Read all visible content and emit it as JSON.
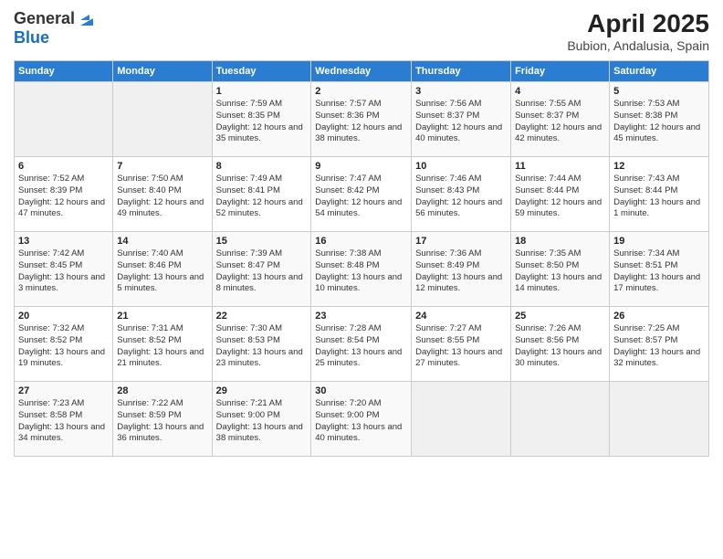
{
  "logo": {
    "general": "General",
    "blue": "Blue"
  },
  "title": "April 2025",
  "subtitle": "Bubion, Andalusia, Spain",
  "headers": [
    "Sunday",
    "Monday",
    "Tuesday",
    "Wednesday",
    "Thursday",
    "Friday",
    "Saturday"
  ],
  "weeks": [
    [
      {
        "day": "",
        "sunrise": "",
        "sunset": "",
        "daylight": ""
      },
      {
        "day": "",
        "sunrise": "",
        "sunset": "",
        "daylight": ""
      },
      {
        "day": "1",
        "sunrise": "Sunrise: 7:59 AM",
        "sunset": "Sunset: 8:35 PM",
        "daylight": "Daylight: 12 hours and 35 minutes."
      },
      {
        "day": "2",
        "sunrise": "Sunrise: 7:57 AM",
        "sunset": "Sunset: 8:36 PM",
        "daylight": "Daylight: 12 hours and 38 minutes."
      },
      {
        "day": "3",
        "sunrise": "Sunrise: 7:56 AM",
        "sunset": "Sunset: 8:37 PM",
        "daylight": "Daylight: 12 hours and 40 minutes."
      },
      {
        "day": "4",
        "sunrise": "Sunrise: 7:55 AM",
        "sunset": "Sunset: 8:37 PM",
        "daylight": "Daylight: 12 hours and 42 minutes."
      },
      {
        "day": "5",
        "sunrise": "Sunrise: 7:53 AM",
        "sunset": "Sunset: 8:38 PM",
        "daylight": "Daylight: 12 hours and 45 minutes."
      }
    ],
    [
      {
        "day": "6",
        "sunrise": "Sunrise: 7:52 AM",
        "sunset": "Sunset: 8:39 PM",
        "daylight": "Daylight: 12 hours and 47 minutes."
      },
      {
        "day": "7",
        "sunrise": "Sunrise: 7:50 AM",
        "sunset": "Sunset: 8:40 PM",
        "daylight": "Daylight: 12 hours and 49 minutes."
      },
      {
        "day": "8",
        "sunrise": "Sunrise: 7:49 AM",
        "sunset": "Sunset: 8:41 PM",
        "daylight": "Daylight: 12 hours and 52 minutes."
      },
      {
        "day": "9",
        "sunrise": "Sunrise: 7:47 AM",
        "sunset": "Sunset: 8:42 PM",
        "daylight": "Daylight: 12 hours and 54 minutes."
      },
      {
        "day": "10",
        "sunrise": "Sunrise: 7:46 AM",
        "sunset": "Sunset: 8:43 PM",
        "daylight": "Daylight: 12 hours and 56 minutes."
      },
      {
        "day": "11",
        "sunrise": "Sunrise: 7:44 AM",
        "sunset": "Sunset: 8:44 PM",
        "daylight": "Daylight: 12 hours and 59 minutes."
      },
      {
        "day": "12",
        "sunrise": "Sunrise: 7:43 AM",
        "sunset": "Sunset: 8:44 PM",
        "daylight": "Daylight: 13 hours and 1 minute."
      }
    ],
    [
      {
        "day": "13",
        "sunrise": "Sunrise: 7:42 AM",
        "sunset": "Sunset: 8:45 PM",
        "daylight": "Daylight: 13 hours and 3 minutes."
      },
      {
        "day": "14",
        "sunrise": "Sunrise: 7:40 AM",
        "sunset": "Sunset: 8:46 PM",
        "daylight": "Daylight: 13 hours and 5 minutes."
      },
      {
        "day": "15",
        "sunrise": "Sunrise: 7:39 AM",
        "sunset": "Sunset: 8:47 PM",
        "daylight": "Daylight: 13 hours and 8 minutes."
      },
      {
        "day": "16",
        "sunrise": "Sunrise: 7:38 AM",
        "sunset": "Sunset: 8:48 PM",
        "daylight": "Daylight: 13 hours and 10 minutes."
      },
      {
        "day": "17",
        "sunrise": "Sunrise: 7:36 AM",
        "sunset": "Sunset: 8:49 PM",
        "daylight": "Daylight: 13 hours and 12 minutes."
      },
      {
        "day": "18",
        "sunrise": "Sunrise: 7:35 AM",
        "sunset": "Sunset: 8:50 PM",
        "daylight": "Daylight: 13 hours and 14 minutes."
      },
      {
        "day": "19",
        "sunrise": "Sunrise: 7:34 AM",
        "sunset": "Sunset: 8:51 PM",
        "daylight": "Daylight: 13 hours and 17 minutes."
      }
    ],
    [
      {
        "day": "20",
        "sunrise": "Sunrise: 7:32 AM",
        "sunset": "Sunset: 8:52 PM",
        "daylight": "Daylight: 13 hours and 19 minutes."
      },
      {
        "day": "21",
        "sunrise": "Sunrise: 7:31 AM",
        "sunset": "Sunset: 8:52 PM",
        "daylight": "Daylight: 13 hours and 21 minutes."
      },
      {
        "day": "22",
        "sunrise": "Sunrise: 7:30 AM",
        "sunset": "Sunset: 8:53 PM",
        "daylight": "Daylight: 13 hours and 23 minutes."
      },
      {
        "day": "23",
        "sunrise": "Sunrise: 7:28 AM",
        "sunset": "Sunset: 8:54 PM",
        "daylight": "Daylight: 13 hours and 25 minutes."
      },
      {
        "day": "24",
        "sunrise": "Sunrise: 7:27 AM",
        "sunset": "Sunset: 8:55 PM",
        "daylight": "Daylight: 13 hours and 27 minutes."
      },
      {
        "day": "25",
        "sunrise": "Sunrise: 7:26 AM",
        "sunset": "Sunset: 8:56 PM",
        "daylight": "Daylight: 13 hours and 30 minutes."
      },
      {
        "day": "26",
        "sunrise": "Sunrise: 7:25 AM",
        "sunset": "Sunset: 8:57 PM",
        "daylight": "Daylight: 13 hours and 32 minutes."
      }
    ],
    [
      {
        "day": "27",
        "sunrise": "Sunrise: 7:23 AM",
        "sunset": "Sunset: 8:58 PM",
        "daylight": "Daylight: 13 hours and 34 minutes."
      },
      {
        "day": "28",
        "sunrise": "Sunrise: 7:22 AM",
        "sunset": "Sunset: 8:59 PM",
        "daylight": "Daylight: 13 hours and 36 minutes."
      },
      {
        "day": "29",
        "sunrise": "Sunrise: 7:21 AM",
        "sunset": "Sunset: 9:00 PM",
        "daylight": "Daylight: 13 hours and 38 minutes."
      },
      {
        "day": "30",
        "sunrise": "Sunrise: 7:20 AM",
        "sunset": "Sunset: 9:00 PM",
        "daylight": "Daylight: 13 hours and 40 minutes."
      },
      {
        "day": "",
        "sunrise": "",
        "sunset": "",
        "daylight": ""
      },
      {
        "day": "",
        "sunrise": "",
        "sunset": "",
        "daylight": ""
      },
      {
        "day": "",
        "sunrise": "",
        "sunset": "",
        "daylight": ""
      }
    ]
  ]
}
